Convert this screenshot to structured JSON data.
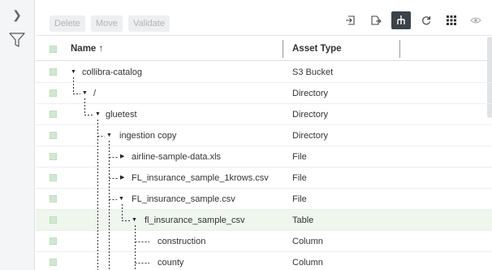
{
  "toolbar": {
    "delete_label": "Delete",
    "move_label": "Move",
    "validate_label": "Validate"
  },
  "columns": {
    "name": "Name ↑",
    "asset_type": "Asset Type"
  },
  "rows": [
    {
      "name": "collibra-catalog",
      "type": "S3 Bucket"
    },
    {
      "name": "/",
      "type": "Directory"
    },
    {
      "name": "gluetest",
      "type": "Directory"
    },
    {
      "name": "ingestion copy",
      "type": "Directory"
    },
    {
      "name": "airline-sample-data.xls",
      "type": "File"
    },
    {
      "name": "FL_insurance_sample_1krows.csv",
      "type": "File"
    },
    {
      "name": "FL_insurance_sample.csv",
      "type": "File"
    },
    {
      "name": "fl_insurance_sample_csv",
      "type": "Table"
    },
    {
      "name": "construction",
      "type": "Column"
    },
    {
      "name": "county",
      "type": "Column"
    }
  ],
  "icons": {
    "rail_expand": "chevron-right-icon",
    "rail_filter": "filter-icon",
    "tool1": "import-icon",
    "tool2": "export-icon",
    "tool3": "hierarchy-icon",
    "tool4": "refresh-icon",
    "tool5": "grid-icon",
    "tool6": "eye-icon"
  },
  "colors": {
    "checkbox": "#cfe8cf",
    "selected_row": "#eef6ee",
    "active_tool": "#3b4249"
  }
}
